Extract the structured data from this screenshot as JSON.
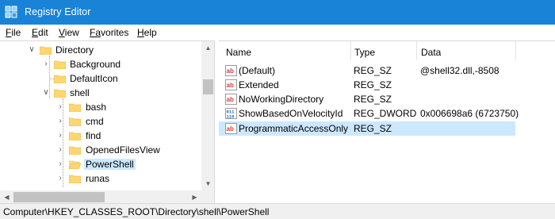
{
  "window": {
    "title": "Registry Editor",
    "icon": "registry-icon",
    "accent": "#1883d7"
  },
  "menubar": [
    {
      "key": "F",
      "rest": "ile"
    },
    {
      "key": "E",
      "rest": "dit"
    },
    {
      "key": "V",
      "rest": "iew"
    },
    {
      "key": "Fa",
      "rest": "vorites"
    },
    {
      "key": "H",
      "rest": "elp"
    }
  ],
  "tree": {
    "items": [
      {
        "label": "Directory",
        "expander": "expanded"
      },
      {
        "label": "Background",
        "expander": "collapsed"
      },
      {
        "label": "DefaultIcon",
        "expander": "none"
      },
      {
        "label": "shell",
        "expander": "expanded"
      },
      {
        "label": "bash",
        "expander": "collapsed"
      },
      {
        "label": "cmd",
        "expander": "collapsed"
      },
      {
        "label": "find",
        "expander": "collapsed"
      },
      {
        "label": "OpenedFilesView",
        "expander": "collapsed"
      },
      {
        "label": "PowerShell",
        "expander": "collapsed",
        "selected": true
      },
      {
        "label": "runas",
        "expander": "collapsed"
      }
    ]
  },
  "list": {
    "columns": [
      "Name",
      "Type",
      "Data"
    ],
    "rows": [
      {
        "name": "(Default)",
        "type": "REG_SZ",
        "data": "@shell32.dll,-8508",
        "icon": "string-value-icon"
      },
      {
        "name": "Extended",
        "type": "REG_SZ",
        "data": "",
        "icon": "string-value-icon"
      },
      {
        "name": "NoWorkingDirectory",
        "type": "REG_SZ",
        "data": "",
        "icon": "string-value-icon"
      },
      {
        "name": "ShowBasedOnVelocityId",
        "type": "REG_DWORD",
        "data": "0x006698a6 (6723750)",
        "icon": "dword-value-icon"
      },
      {
        "name": "ProgrammaticAccessOnly",
        "type": "REG_SZ",
        "data": "",
        "icon": "string-value-icon",
        "selected": true
      }
    ]
  },
  "status": {
    "path": "Computer\\HKEY_CLASSES_ROOT\\Directory\\shell\\PowerShell"
  },
  "colors": {
    "selection": "#cce8ff",
    "folder": "#ffd76e"
  }
}
